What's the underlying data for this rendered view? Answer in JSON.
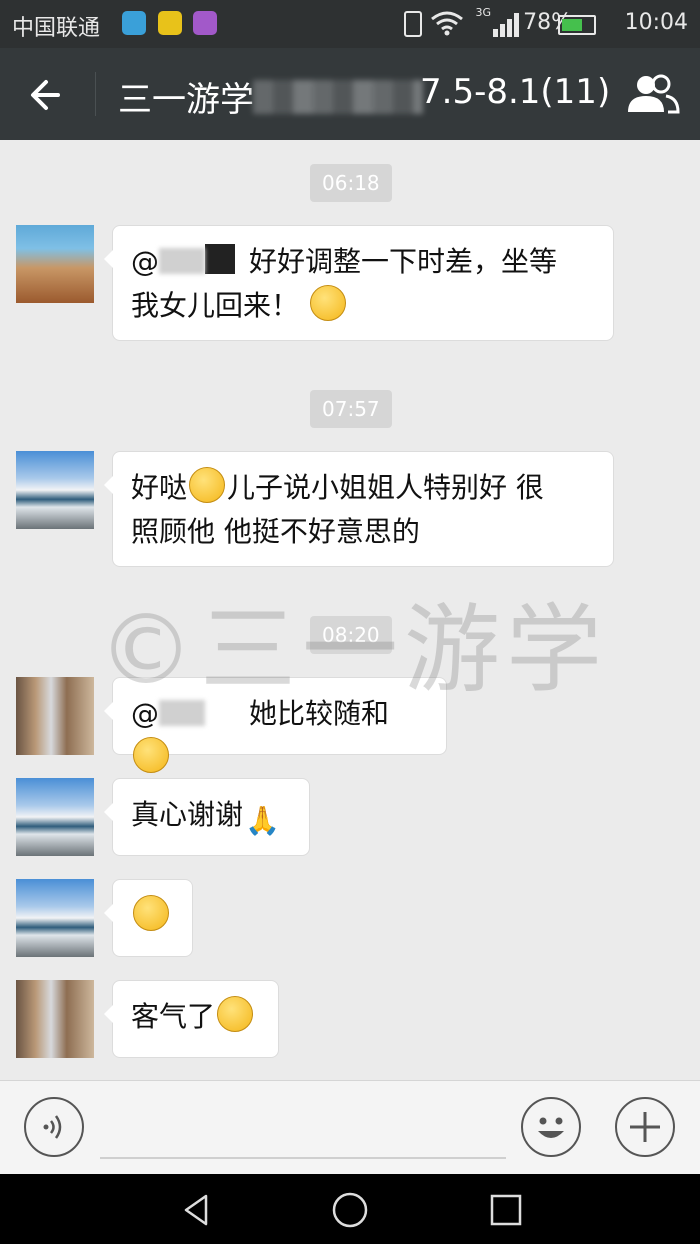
{
  "status_bar": {
    "carrier": "中国联通",
    "network_type": "3G",
    "battery_percent": "78%",
    "time": "10:04",
    "battery_level": 0.78,
    "colors": {
      "background": "#2e3132",
      "battery_fill": "#45c04d"
    }
  },
  "title_bar": {
    "title_prefix": "三一游学",
    "title_suffix": "7.5-8.1(11)",
    "back_icon": "arrow-left-icon",
    "members_icon": "group-members-icon",
    "colors": {
      "background": "#34393b"
    }
  },
  "chat": {
    "timestamps": [
      "06:18",
      "07:57",
      "08:20"
    ],
    "messages": [
      {
        "mention": "@",
        "text": "好好调整一下时差，坐等",
        "text_line2": "我女儿回来！",
        "emoji": "smile-emoji"
      },
      {
        "text": "好哒",
        "text_after_emoji": "儿子说小姐姐人特别好 很",
        "text_line2": "照顾他 他挺不好意思的",
        "emoji": "grin-emoji"
      },
      {
        "mention": "@",
        "text": "她比较随和",
        "emoji": "blush-emoji"
      },
      {
        "text": "真心谢谢",
        "emoji": "pray-emoji"
      },
      {
        "text": "",
        "emoji": "grin-emoji"
      },
      {
        "text": "客气了",
        "emoji": "heart-eyes-emoji"
      }
    ],
    "watermark": "©三一游学"
  },
  "input_bar": {
    "voice_icon": "voice-icon",
    "emoji_icon": "emoji-face-icon",
    "plus_icon": "plus-icon"
  },
  "nav_bar": {
    "back_icon": "triangle-back-icon",
    "home_icon": "circle-home-icon",
    "recent_icon": "square-recent-icon"
  }
}
